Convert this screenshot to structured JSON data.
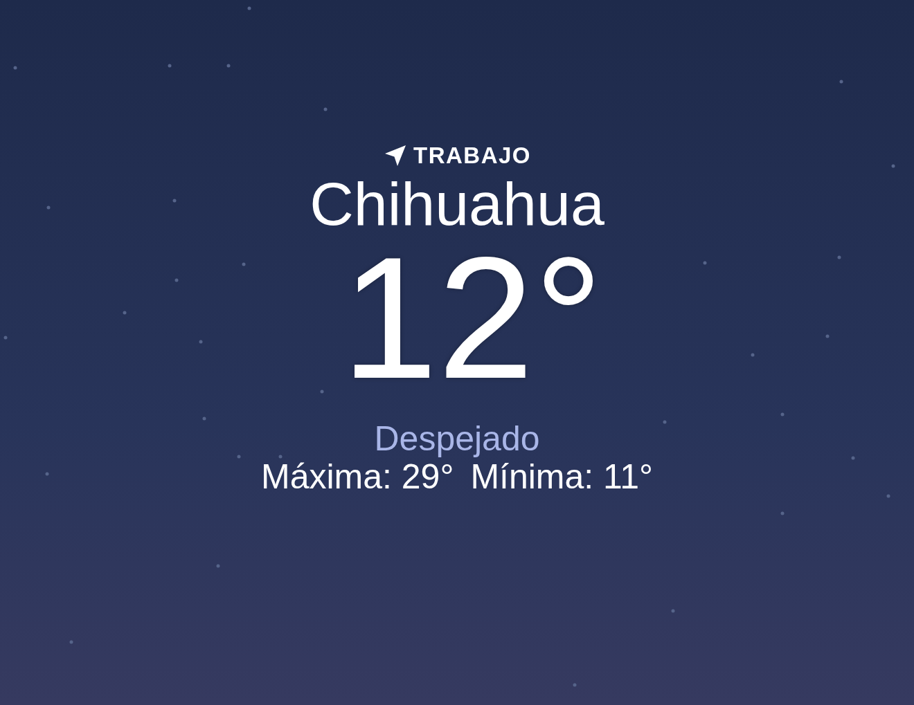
{
  "location_label": "TRABAJO",
  "city": "Chihuahua",
  "temperature": "12°",
  "condition": "Despejado",
  "high": "Máxima: 29°",
  "low": "Mínima: 11°"
}
